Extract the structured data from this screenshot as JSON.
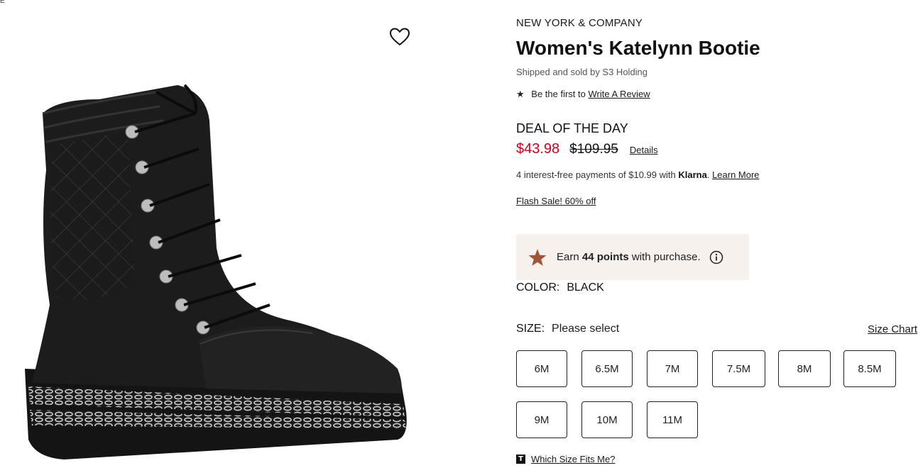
{
  "topmark": "E",
  "product": {
    "brand": "NEW YORK & COMPANY",
    "title": "Women's Katelynn Bootie",
    "seller": "Shipped and sold by S3 Holding",
    "review_prefix": "Be the first to",
    "review_link": "Write A Review",
    "deal_label": "DEAL OF THE DAY",
    "sale_price": "$43.98",
    "original_price": "$109.95",
    "details_link": "Details",
    "klarna_prefix": "4 interest-free payments of $10.99 with",
    "klarna_brand": "Klarna",
    "klarna_link": "Learn More",
    "flash_sale": "Flash Sale! 60% off"
  },
  "points": {
    "prefix": "Earn",
    "amount": "44 points",
    "suffix": "with purchase."
  },
  "color": {
    "label": "COLOR:",
    "value": "BLACK"
  },
  "size": {
    "label": "SIZE:",
    "value": "Please select",
    "chart_link": "Size Chart",
    "options": [
      "6M",
      "6.5M",
      "7M",
      "7.5M",
      "8M",
      "8.5M",
      "9M",
      "10M",
      "11M"
    ],
    "fit_icon": "T",
    "fit_link": "Which Size Fits Me?"
  },
  "icons": {
    "wishlist": "heart-icon",
    "review_star": "star-icon",
    "points_star": "star-icon",
    "info": "info-icon",
    "fit": "t-icon"
  },
  "colors": {
    "sale": "#d0021b",
    "points_bg": "#f7f1ee",
    "points_star": "#a0553a"
  }
}
